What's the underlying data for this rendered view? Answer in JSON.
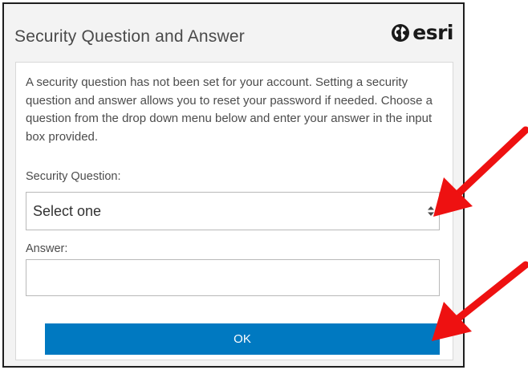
{
  "dialog": {
    "title": "Security Question and Answer",
    "brand": "esri",
    "brand_icon": "globe-icon"
  },
  "intro_text": "A security question has not been set for your account. Setting a security question and answer allows you to reset your password if needed. Choose a question from the drop down menu below and enter your answer in the input box provided.",
  "security_question": {
    "label": "Security Question:",
    "selected_value": "Select one",
    "icon": "up-down-caret-icon"
  },
  "answer": {
    "label": "Answer:",
    "value": "",
    "placeholder": ""
  },
  "ok_button": {
    "label": "OK"
  },
  "annotations": {
    "arrow_color": "#ee1111",
    "arrows": [
      "points-to-security-question-dropdown",
      "points-to-ok-button"
    ]
  },
  "colors": {
    "dialog_background": "#f3f3f3",
    "panel_background": "#ffffff",
    "button_blue": "#0079c1"
  }
}
